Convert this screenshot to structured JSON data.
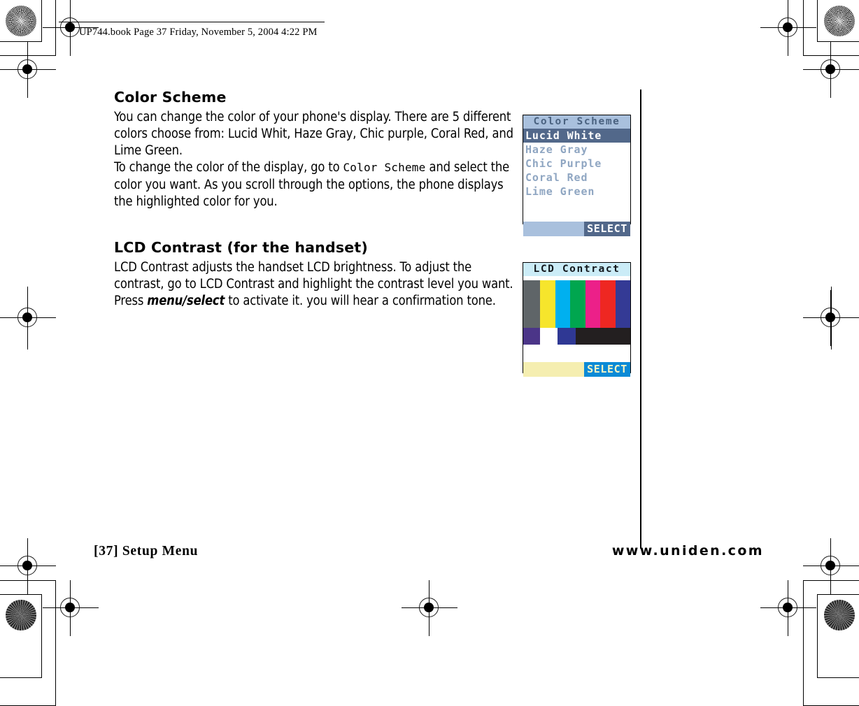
{
  "print_slug": "UP744.book  Page 37  Friday, November 5, 2004  4:22 PM",
  "sections": [
    {
      "heading": "Color Scheme",
      "paragraph_1": "You can change the color of your phone's display. There are 5 different colors choose from: Lucid Whit, Haze Gray, Chic purple, Coral Red, and Lime Green.",
      "paragraph_2_pre": "To change the color of the display, go to ",
      "paragraph_2_mono": "Color Scheme",
      "paragraph_2_post": " and select the color you want. As you scroll through the options, the phone displays the highlighted color for you."
    },
    {
      "heading": "LCD Contrast (for the handset)",
      "paragraph_1_pre": "LCD Contrast adjusts the handset LCD brightness. To adjust the contrast, go to LCD Contrast and highlight the contrast level you want. Press ",
      "paragraph_1_emphasis": "menu/select",
      "paragraph_1_post": " to activate it. you will hear a confirmation tone."
    }
  ],
  "color_scheme_screen": {
    "title": "Color Scheme",
    "options": [
      {
        "label": "Lucid White",
        "selected": true
      },
      {
        "label": "Haze Gray",
        "selected": false
      },
      {
        "label": "Chic Purple",
        "selected": false
      },
      {
        "label": "Coral Red",
        "selected": false
      },
      {
        "label": "Lime Green",
        "selected": false
      }
    ],
    "softkey_right": "SELECT",
    "colors": {
      "title_bg": "#a9c0dd",
      "title_fg": "#4a6280",
      "row_fg": "#8fa6c2",
      "selected_bg": "#52688a",
      "selected_fg": "#ffffff",
      "softbar_left_bg": "#a9c0dd",
      "softbar_right_bg": "#52688a"
    }
  },
  "lcd_contrast_screen": {
    "title": "LCD Contract",
    "softkey_right": "SELECT",
    "colors": {
      "title_bg": "#cbecf7",
      "title_fg": "#12171c",
      "softbar_left_bg": "#f5eeb0",
      "softbar_right_bg": "#0b8ad6",
      "softbar_right_fg": "#f7f4c4"
    },
    "bars_top": [
      {
        "name": "gray",
        "hex": "#5f6568",
        "width": 16
      },
      {
        "name": "yellow",
        "hex": "#f6e52c",
        "width": 14
      },
      {
        "name": "cyan",
        "hex": "#00b0ef",
        "width": 14
      },
      {
        "name": "green",
        "hex": "#00a64f",
        "width": 14
      },
      {
        "name": "magenta",
        "hex": "#ec2089",
        "width": 14
      },
      {
        "name": "red",
        "hex": "#ee2722",
        "width": 14
      },
      {
        "name": "navy",
        "hex": "#343a95",
        "width": 14
      }
    ],
    "bars_bottom": [
      {
        "name": "purple",
        "hex": "#4b3588",
        "width": 16
      },
      {
        "name": "white",
        "hex": "#ffffff",
        "width": 16
      },
      {
        "name": "blue",
        "hex": "#2f3894",
        "width": 17
      },
      {
        "name": "black",
        "hex": "#231f20",
        "width": 51
      }
    ]
  },
  "footer": {
    "page_label": "[37] Setup Menu",
    "website": "www.uniden.com"
  }
}
